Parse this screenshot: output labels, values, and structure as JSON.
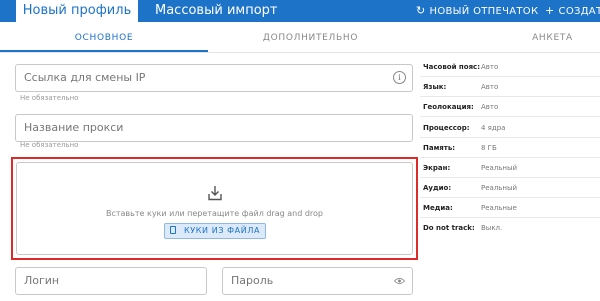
{
  "header": {
    "tab_new_profile": "Новый профиль",
    "tab_bulk_import": "Массовый импорт",
    "new_fingerprint": "НОВЫЙ ОТПЕЧАТОК",
    "create": "СОЗДАТЬ"
  },
  "subtabs": {
    "basic": "ОСНОВНОЕ",
    "additional": "ДОПОЛНИТЕЛЬНО",
    "anketa": "АНКЕТА"
  },
  "form": {
    "ip_change_link": {
      "placeholder": "Ссылка для смены IP",
      "hint": "Не обязательно"
    },
    "proxy_name": {
      "placeholder": "Название прокси",
      "hint": "Не обязательно"
    },
    "cookies": {
      "instruction": "Вставьте куки или перетащите файл drag and drop",
      "button": "КУКИ ИЗ ФАЙЛА"
    },
    "login": {
      "placeholder": "Логин"
    },
    "password": {
      "placeholder": "Пароль"
    }
  },
  "settings": [
    {
      "key": "Часовой пояс:",
      "value": "Авто"
    },
    {
      "key": "Язык:",
      "value": "Авто"
    },
    {
      "key": "Геолокация:",
      "value": "Авто"
    },
    {
      "key": "Процессор:",
      "value": "4 ядра"
    },
    {
      "key": "Память:",
      "value": "8 ГБ"
    },
    {
      "key": "Экран:",
      "value": "Реальный"
    },
    {
      "key": "Аудио:",
      "value": "Реальный"
    },
    {
      "key": "Медиа:",
      "value": "Реальные"
    },
    {
      "key": "Do not track:",
      "value": "Выкл."
    }
  ],
  "colors": {
    "accent": "#1d73c7",
    "highlight": "#e02a2a"
  },
  "icons": {
    "new_fingerprint": "refresh-icon",
    "create": "plus-icon",
    "info": "info-icon",
    "dropzone": "download-icon",
    "cookie_button": "file-icon",
    "password": "eye-icon"
  }
}
